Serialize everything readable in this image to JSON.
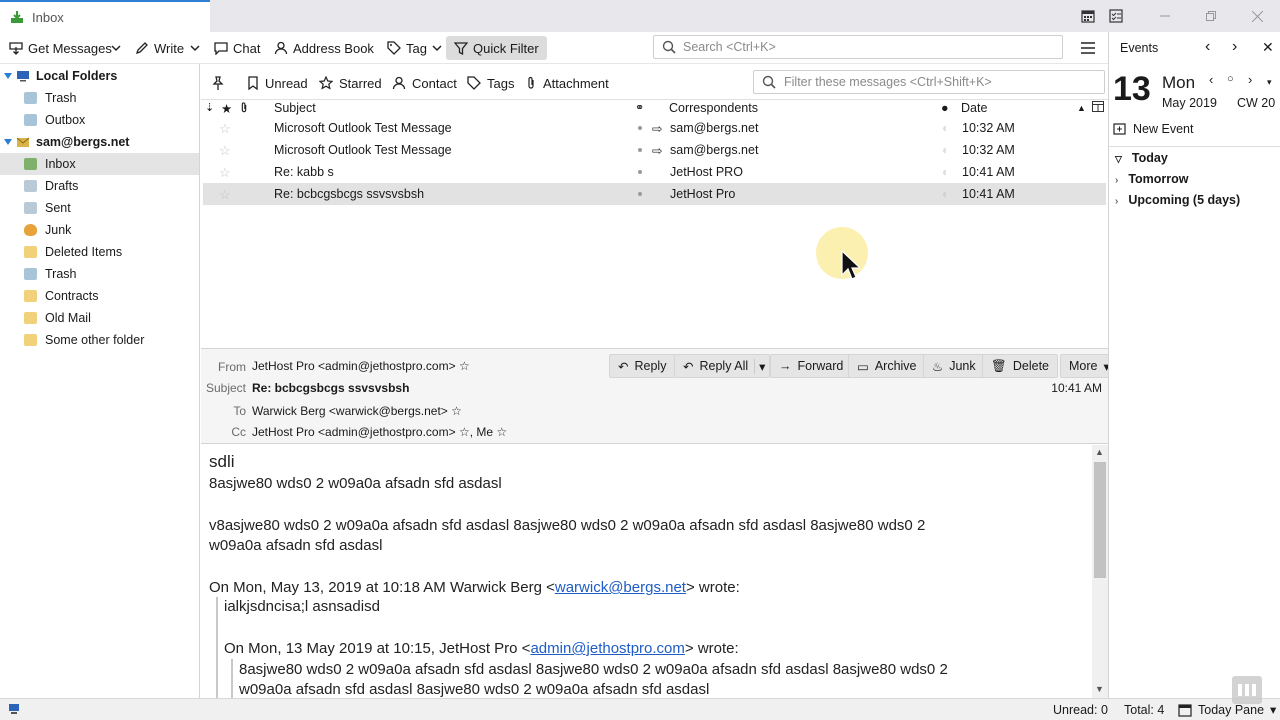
{
  "window": {
    "tab_title": "Inbox"
  },
  "toolbar": {
    "get_messages": "Get Messages",
    "write": "Write",
    "chat": "Chat",
    "address_book": "Address Book",
    "tag": "Tag",
    "quick_filter": "Quick Filter",
    "search_placeholder": "Search <Ctrl+K>"
  },
  "folders": {
    "local_folders": "Local Folders",
    "local_items": [
      "Trash",
      "Outbox"
    ],
    "account": "sam@bergs.net",
    "account_items": [
      "Inbox",
      "Drafts",
      "Sent",
      "Junk",
      "Deleted Items",
      "Trash",
      "Contracts",
      "Old Mail",
      "Some other folder"
    ],
    "selected": "Inbox"
  },
  "quickfilter": {
    "unread": "Unread",
    "starred": "Starred",
    "contact": "Contact",
    "tags": "Tags",
    "attachment": "Attachment",
    "filter_placeholder": "Filter these messages <Ctrl+Shift+K>"
  },
  "thread_columns": {
    "subject": "Subject",
    "correspondents": "Correspondents",
    "date": "Date"
  },
  "messages": [
    {
      "subject": "Microsoft Outlook Test Message",
      "correspondent": "sam@bergs.net",
      "date": "10:32 AM",
      "outgoing": true
    },
    {
      "subject": "Microsoft Outlook Test Message",
      "correspondent": "sam@bergs.net",
      "date": "10:32 AM",
      "outgoing": true
    },
    {
      "subject": "Re: kabb s",
      "correspondent": "JetHost PRO",
      "date": "10:41 AM",
      "outgoing": false
    },
    {
      "subject": "Re: bcbcgsbcgs ssvsvsbsh",
      "correspondent": "JetHost Pro",
      "date": "10:41 AM",
      "outgoing": false,
      "selected": true
    }
  ],
  "header": {
    "from_label": "From",
    "from": "JetHost Pro <admin@jethostpro.com>",
    "subject_label": "Subject",
    "subject": "Re: bcbcgsbcgs ssvsvsbsh",
    "time": "10:41 AM",
    "to_label": "To",
    "to": "Warwick Berg <warwick@bergs.net>",
    "cc_label": "Cc",
    "cc": "JetHost Pro <admin@jethostpro.com>",
    "cc_me": ", Me",
    "buttons": {
      "reply": "Reply",
      "reply_all": "Reply All",
      "forward": "Forward",
      "archive": "Archive",
      "junk": "Junk",
      "delete": "Delete",
      "more": "More"
    }
  },
  "body": {
    "line1": "sdli",
    "line2": "8asjwe80 wds0 2 w09a0a afsadn sfd asdasl",
    "line3": "v8asjwe80 wds0 2 w09a0a afsadn sfd asdasl 8asjwe80 wds0 2 w09a0a afsadn sfd asdasl 8asjwe80 wds0 2",
    "line4": "w09a0a afsadn sfd asdasl",
    "quote1_prefix": "On Mon, May 13, 2019 at 10:18 AM Warwick Berg <",
    "quote1_link": "warwick@bergs.net",
    "quote1_suffix": "> wrote:",
    "quote1_text": "ialkjsdncisa;l asnsadisd",
    "quote2_prefix": "On Mon, 13 May 2019 at 10:15, JetHost Pro <",
    "quote2_link": "admin@jethostpro.com",
    "quote2_suffix": "> wrote:",
    "quote2_line1": "8asjwe80 wds0 2 w09a0a afsadn sfd asdasl  8asjwe80 wds0 2 w09a0a afsadn sfd asdasl 8asjwe80 wds0 2",
    "quote2_line2": "w09a0a afsadn sfd asdasl 8asjwe80 wds0 2 w09a0a afsadn sfd asdasl"
  },
  "today_pane": {
    "title": "Events",
    "day_num": "13",
    "day_name": "Mon",
    "month_year": "May 2019",
    "week": "CW 20",
    "new_event": "New Event",
    "sections": [
      "Today",
      "Tomorrow",
      "Upcoming (5 days)"
    ]
  },
  "status": {
    "unread": "Unread: 0",
    "total": "Total: 4",
    "today_pane": "Today Pane"
  }
}
